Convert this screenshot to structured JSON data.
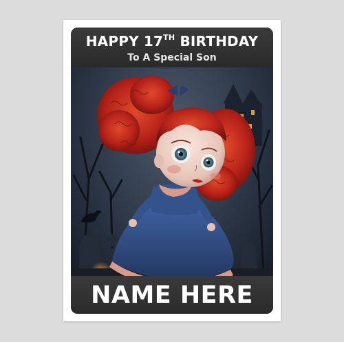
{
  "card": {
    "headline_prefix": "HAPPY 17",
    "headline_ordinal": "TH",
    "headline_suffix": " BIRTHDAY",
    "subline": "To A Special Son",
    "name_placeholder": "NAME HERE"
  },
  "artwork": {
    "subject": "doll-with-red-curly-hair",
    "palette": {
      "hair": "#c0281a",
      "dress": "#2f4f8a",
      "sky": "#2b3646",
      "banner": "#2e2e2e"
    }
  }
}
